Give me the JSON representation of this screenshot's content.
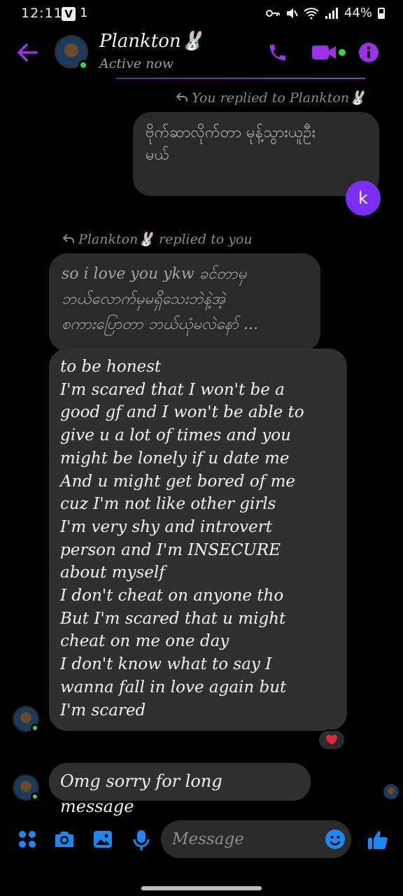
{
  "status": {
    "time": "12:11",
    "v_badge": "V",
    "network": "1",
    "battery": "44%"
  },
  "header": {
    "name": "Plankton🐰",
    "status": "Active now"
  },
  "thread": {
    "reply_label_1": "You replied to Plankton🐰",
    "sent_quote": "ဗိုက်ဆာလိုက်တာ မုန့်သွားယူဦး\nမယ်",
    "sender_initial": "k",
    "reply_label_2": "Plankton🐰 replied to you",
    "quoted_text": "so i love you ykw ခင်တာမှ\nဘယ်လောက်မှမရှိသေးဘဲနဲ့အဲ့\nစကားပြောတာ ဘယ်ယုံမလဲနော် ...",
    "long_message": "to be honest\nI'm scared that I won't be a\ngood gf and I won't be able to\ngive u a lot of times and you\nmight be lonely if u date me\nAnd u might get bored of me\ncuz I'm not like other girls\nI'm very shy and introvert\nperson and I'm INSECURE\nabout myself\n I don't cheat on anyone tho\nBut I'm scared that u might\ncheat on me one day\nI don't know what to say I\nwanna fall in love again but\nI'm scared",
    "reaction": "❤️",
    "last_message": "Omg sorry for long message"
  },
  "composer": {
    "placeholder": "Message"
  },
  "colors": {
    "accent": "#9b32e8",
    "messenger_blue": "#1e88f0",
    "bubble": "#303030",
    "online": "#3bd14a"
  },
  "icons": [
    "back-arrow-icon",
    "phone-icon",
    "video-icon",
    "info-icon",
    "grid-icon",
    "camera-icon",
    "gallery-icon",
    "mic-icon",
    "emoji-icon",
    "thumbs-up-icon",
    "heart-icon"
  ]
}
